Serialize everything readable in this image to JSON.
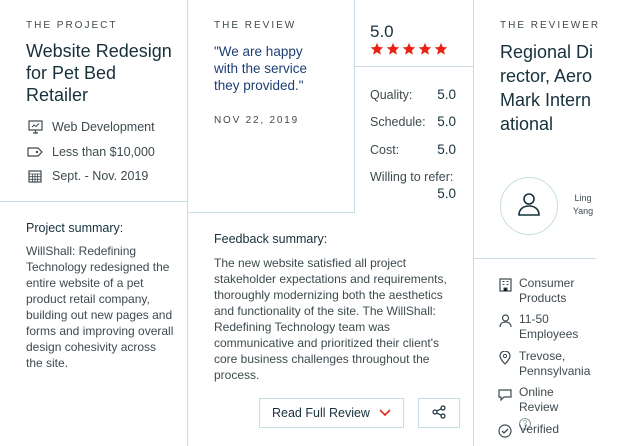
{
  "project": {
    "eyebrow": "THE PROJECT",
    "title": "Website Redesign for Pet Bed Retailer",
    "meta": [
      {
        "icon": "monitor-icon",
        "text": "Web Development"
      },
      {
        "icon": "price-tag-icon",
        "text": "Less than $10,000"
      },
      {
        "icon": "calendar-icon",
        "text": "Sept. - Nov. 2019"
      }
    ],
    "summary_label": "Project summary:",
    "summary_text": "WillShall: Redefining Technology redesigned the entire website of a pet product retail company, building out new pages and forms and improving overall design cohesivity across the site."
  },
  "review": {
    "eyebrow": "THE REVIEW",
    "quote": "\"We are happy with the service they provided.\"",
    "date": "NOV 22, 2019",
    "score": "5.0",
    "stars": 5,
    "star_color": "#e62415",
    "ratings": [
      {
        "label": "Quality:",
        "value": "5.0"
      },
      {
        "label": "Schedule:",
        "value": "5.0"
      },
      {
        "label": "Cost:",
        "value": "5.0"
      },
      {
        "label": "Willing to refer:",
        "value": "5.0"
      }
    ],
    "feedback_label": "Feedback summary:",
    "feedback_text": "The new website satisfied all project stakeholder expectations and requirements, thoroughly modernizing both the aesthetics and functionality of the site. The WillShall: Redefining Technology team was communicative and prioritized their client's core business challenges throughout the process.",
    "read_button": "Read Full Review",
    "accent_color": "#e62415"
  },
  "reviewer": {
    "eyebrow": "THE REVIEWER",
    "title": "Regional Director, AeroMark International",
    "name_line1": "Ling",
    "name_line2": "Yang",
    "info": [
      {
        "icon": "building-icon",
        "text": "Consumer Products"
      },
      {
        "icon": "user-icon",
        "text": "11-50 Employees"
      },
      {
        "icon": "location-pin-icon",
        "text": "Trevose, Pennsylvania"
      },
      {
        "icon": "chat-bubble-icon",
        "text": "Online Review"
      },
      {
        "icon": "check-circle-icon",
        "text": "Verified"
      }
    ]
  }
}
